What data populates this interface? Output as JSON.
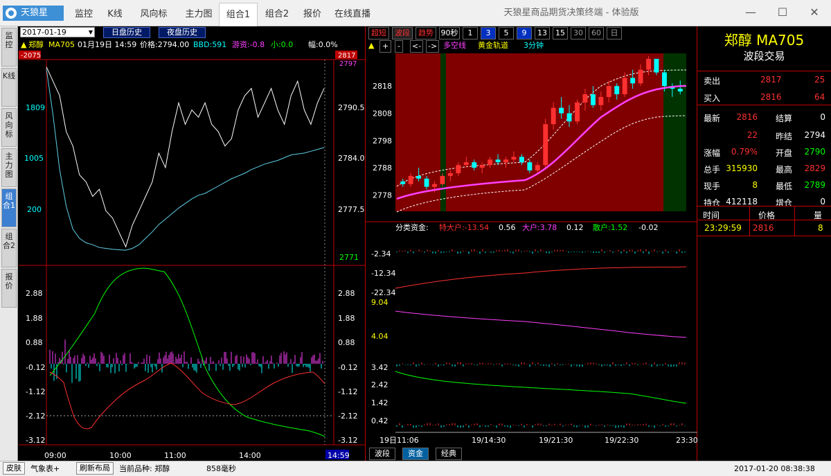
{
  "app": {
    "logo": "天狼星",
    "window_title": "天狼星商品期货决策终端 - 体验版"
  },
  "nav": [
    "监控",
    "K线",
    "风向标",
    "主力图",
    "组合1",
    "组合2",
    "报价",
    "在线直播"
  ],
  "left_tabs": [
    "监控",
    "K线",
    "风向标",
    "主力图",
    "组合1",
    "组合2",
    "报价"
  ],
  "toolbar": {
    "date": "2017-01-19",
    "day_history": "日盘历史",
    "night_history": "夜盘历史"
  },
  "intraday": {
    "name": "郑醇",
    "code": "MA705",
    "datetime": "01月19日 14:59",
    "price_label": "价格:2794.00",
    "bbd": "BBD:591",
    "youzi": "游资:-0.8",
    "xiao": "小:0.0",
    "fu": "幅:0.0%",
    "left_top": "-2075",
    "right_top": "2817",
    "right_top2": "2797",
    "left_ticks": [
      "1809",
      "1005",
      "200"
    ],
    "right_ticks": [
      "2790.5",
      "2784.0",
      "2777.5"
    ],
    "right_low": "2771",
    "ind_ticks": [
      "2.88",
      "1.88",
      "0.88",
      "-0.12",
      "-1.12",
      "-2.12",
      "-3.12"
    ],
    "times": [
      "09:00",
      "10:00",
      "11:00",
      "14:00"
    ],
    "time_end": "14:59",
    "price_series": [
      2797,
      2795,
      2793,
      2788,
      2786,
      2782,
      2781,
      2779,
      2780,
      2777,
      2776,
      2774,
      2772,
      2775,
      2777,
      2779,
      2781,
      2785,
      2783,
      2788,
      2792,
      2789,
      2791,
      2790,
      2792,
      2789,
      2788,
      2786,
      2787,
      2791,
      2793,
      2794,
      2790,
      2792,
      2794,
      2791,
      2789,
      2793,
      2795,
      2791,
      2789,
      2792,
      2794
    ],
    "fund_series": [
      1400,
      900,
      300,
      -100,
      -350,
      -450,
      -500,
      -520,
      -550,
      -560,
      -570,
      -575,
      -580,
      -560,
      -520,
      -450,
      -380,
      -300,
      -240,
      -180,
      -120,
      -70,
      -20,
      20,
      40,
      80,
      120,
      160,
      200,
      230,
      260,
      300,
      330,
      360,
      380,
      400,
      430,
      460,
      470,
      480,
      500,
      520,
      540
    ]
  },
  "kline": {
    "buttons": [
      "超短",
      "波段",
      "趋势",
      "90秒",
      "1",
      "3",
      "5",
      "9",
      "13",
      "15",
      "30",
      "60",
      "日"
    ],
    "sub_buttons": [
      "▲",
      "+",
      "-",
      "<-",
      "->"
    ],
    "dkx": "多空线",
    "golden": "黄金轨道",
    "period": "3分钟",
    "yticks": [
      "2818",
      "2808",
      "2798",
      "2788",
      "2778"
    ],
    "candles": [
      [
        2783,
        2784,
        2781,
        2782
      ],
      [
        2782,
        2786,
        2781,
        2785
      ],
      [
        2785,
        2788,
        2783,
        2784
      ],
      [
        2784,
        2785,
        2780,
        2781
      ],
      [
        2781,
        2783,
        2779,
        2782
      ],
      [
        2782,
        2786,
        2781,
        2785
      ],
      [
        2785,
        2787,
        2783,
        2786
      ],
      [
        2786,
        2790,
        2785,
        2789
      ],
      [
        2789,
        2792,
        2788,
        2790
      ],
      [
        2790,
        2791,
        2787,
        2788
      ],
      [
        2788,
        2790,
        2786,
        2789
      ],
      [
        2789,
        2792,
        2788,
        2791
      ],
      [
        2791,
        2793,
        2789,
        2790
      ],
      [
        2790,
        2792,
        2788,
        2791
      ],
      [
        2791,
        2794,
        2790,
        2792
      ],
      [
        2792,
        2793,
        2789,
        2790
      ],
      [
        2790,
        2791,
        2786,
        2787
      ],
      [
        2787,
        2790,
        2786,
        2789
      ],
      [
        2789,
        2806,
        2788,
        2804
      ],
      [
        2804,
        2812,
        2802,
        2810
      ],
      [
        2810,
        2814,
        2806,
        2808
      ],
      [
        2808,
        2811,
        2803,
        2805
      ],
      [
        2805,
        2813,
        2804,
        2812
      ],
      [
        2812,
        2817,
        2809,
        2815
      ],
      [
        2815,
        2818,
        2810,
        2811
      ],
      [
        2811,
        2816,
        2809,
        2814
      ],
      [
        2814,
        2820,
        2812,
        2818
      ],
      [
        2818,
        2819,
        2813,
        2815
      ],
      [
        2815,
        2823,
        2814,
        2821
      ],
      [
        2821,
        2824,
        2817,
        2819
      ],
      [
        2819,
        2826,
        2818,
        2824
      ],
      [
        2824,
        2829,
        2822,
        2828
      ],
      [
        2828,
        2827,
        2822,
        2823
      ],
      [
        2823,
        2824,
        2816,
        2818
      ],
      [
        2818,
        2819,
        2814,
        2817
      ],
      [
        2817,
        2820,
        2815,
        2816
      ]
    ],
    "bottom_tabs": [
      "波段",
      "资金",
      "经典"
    ]
  },
  "fund_panel": {
    "label": "分类资金:",
    "ted": "特大户:-13.54",
    "ted_v": "0.56",
    "da": "大户:3.78",
    "da_v": "0.12",
    "san": "散户:1.52",
    "san_v": "-0.02",
    "ticks1": [
      "-2.34",
      "-12.34",
      "-22.34"
    ],
    "ticks2": [
      "9.04",
      "4.04"
    ],
    "ticks3": [
      "3.42",
      "2.42",
      "1.42",
      "0.42"
    ],
    "dates": [
      "19日11:06",
      "19/14:30",
      "19/21:30",
      "19/22:30",
      "23:30"
    ]
  },
  "quote": {
    "title": "郑醇 MA705",
    "subtitle": "波段交易",
    "sell_label": "卖出",
    "sell_price": "2817",
    "sell_vol": "25",
    "buy_label": "买入",
    "buy_price": "2816",
    "buy_vol": "64",
    "rows": [
      [
        "最新",
        "2816",
        "结算",
        "0"
      ],
      [
        "",
        "22",
        "昨结",
        "2794"
      ],
      [
        "涨幅",
        "0.79%",
        "开盘",
        "2790"
      ],
      [
        "总手",
        "315930",
        "最高",
        "2829"
      ],
      [
        "现手",
        "8",
        "最低",
        "2789"
      ],
      [
        "持仓",
        "412118",
        "增仓",
        "0"
      ]
    ],
    "trade_head": [
      "时间",
      "价格",
      "量"
    ],
    "trade_row": [
      "23:29:59",
      "2816",
      "8"
    ]
  },
  "status": {
    "skin": "皮肤",
    "weather": "气象表+",
    "refresh": "刷新布局",
    "current": "当前品种: 郑醇",
    "latency": "858毫秒",
    "datetime": "2017-01-20 08:38:38"
  },
  "colors": {
    "up": "#ff3030",
    "down": "#00ffff",
    "yellow": "#ffff00",
    "magenta": "#ff40ff",
    "green": "#00ff00",
    "accent": "#3d8fd6"
  }
}
